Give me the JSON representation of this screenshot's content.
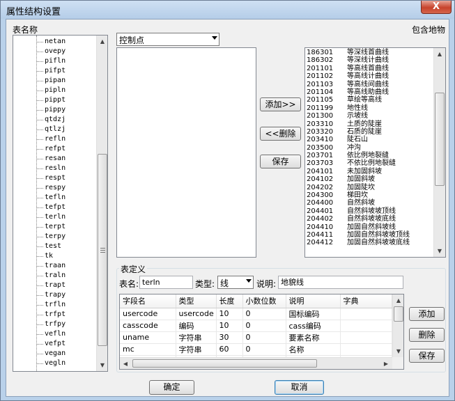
{
  "window": {
    "title": "属性结构设置",
    "close_glyph": "X"
  },
  "left": {
    "title": "表名称",
    "items": [
      "netan",
      "ovepy",
      "pifln",
      "pifpt",
      "pipan",
      "pipln",
      "pippt",
      "pippy",
      "qtdzj",
      "qtlzj",
      "refln",
      "refpt",
      "resan",
      "resln",
      "respt",
      "respy",
      "tefln",
      "tefpt",
      "terln",
      "terpt",
      "terpy",
      "test",
      "tk",
      "traan",
      "traln",
      "trapt",
      "trapy",
      "trfln",
      "trfpt",
      "trfpy",
      "vefln",
      "vefpt",
      "vegan",
      "vegln"
    ]
  },
  "right_top": {
    "include_label": "包含地物",
    "category_select": "控制点",
    "buttons": {
      "add": "添加>>",
      "remove": "<<删除",
      "save": "保存"
    },
    "feature_codes": [
      {
        "code": "186301",
        "name": "等深线首曲线"
      },
      {
        "code": "186302",
        "name": "等深线计曲线"
      },
      {
        "code": "201101",
        "name": "等高线首曲线"
      },
      {
        "code": "201102",
        "name": "等高线计曲线"
      },
      {
        "code": "201103",
        "name": "等高线间曲线"
      },
      {
        "code": "201104",
        "name": "等高线助曲线"
      },
      {
        "code": "201105",
        "name": "草绘等高线"
      },
      {
        "code": "201199",
        "name": "地性线"
      },
      {
        "code": "201300",
        "name": "示坡线"
      },
      {
        "code": "203310",
        "name": "土质的陡崖"
      },
      {
        "code": "203320",
        "name": "石质的陡崖"
      },
      {
        "code": "203410",
        "name": "陡石山"
      },
      {
        "code": "203500",
        "name": "冲沟"
      },
      {
        "code": "203701",
        "name": "依比例地裂缝"
      },
      {
        "code": "203703",
        "name": "不依比例地裂缝"
      },
      {
        "code": "204101",
        "name": "未加固斜坡"
      },
      {
        "code": "204102",
        "name": "加固斜坡"
      },
      {
        "code": "204202",
        "name": "加固陡坎"
      },
      {
        "code": "204300",
        "name": "梯田坎"
      },
      {
        "code": "204400",
        "name": "自然斜坡"
      },
      {
        "code": "204401",
        "name": "自然斜坡坡顶线"
      },
      {
        "code": "204402",
        "name": "自然斜坡坡底线"
      },
      {
        "code": "204410",
        "name": "加固自然斜坡线"
      },
      {
        "code": "204411",
        "name": "加固自然斜坡坡顶线"
      },
      {
        "code": "204412",
        "name": "加固自然斜坡坡底线"
      }
    ]
  },
  "table_def": {
    "title": "表定义",
    "name_label": "表名:",
    "name_value": "terln",
    "type_label": "类型:",
    "type_value": "线",
    "desc_label": "说明:",
    "desc_value": "地貌线",
    "columns": [
      "字段名",
      "类型",
      "长度",
      "小数位数",
      "说明",
      "字典"
    ],
    "rows": [
      [
        "usercode",
        "usercode",
        "10",
        "0",
        "国标编码",
        ""
      ],
      [
        "casscode",
        "编码",
        "10",
        "0",
        "cass编码",
        ""
      ],
      [
        "uname",
        "字符串",
        "30",
        "0",
        "要素名称",
        ""
      ],
      [
        "mc",
        "字符串",
        "60",
        "0",
        "名称",
        ""
      ],
      [
        "",
        "字符串",
        "",
        "",
        "字段",
        ""
      ]
    ],
    "buttons": {
      "add": "添加",
      "delete": "删除",
      "save": "保存"
    }
  },
  "footer": {
    "ok": "确定",
    "cancel": "取消"
  }
}
